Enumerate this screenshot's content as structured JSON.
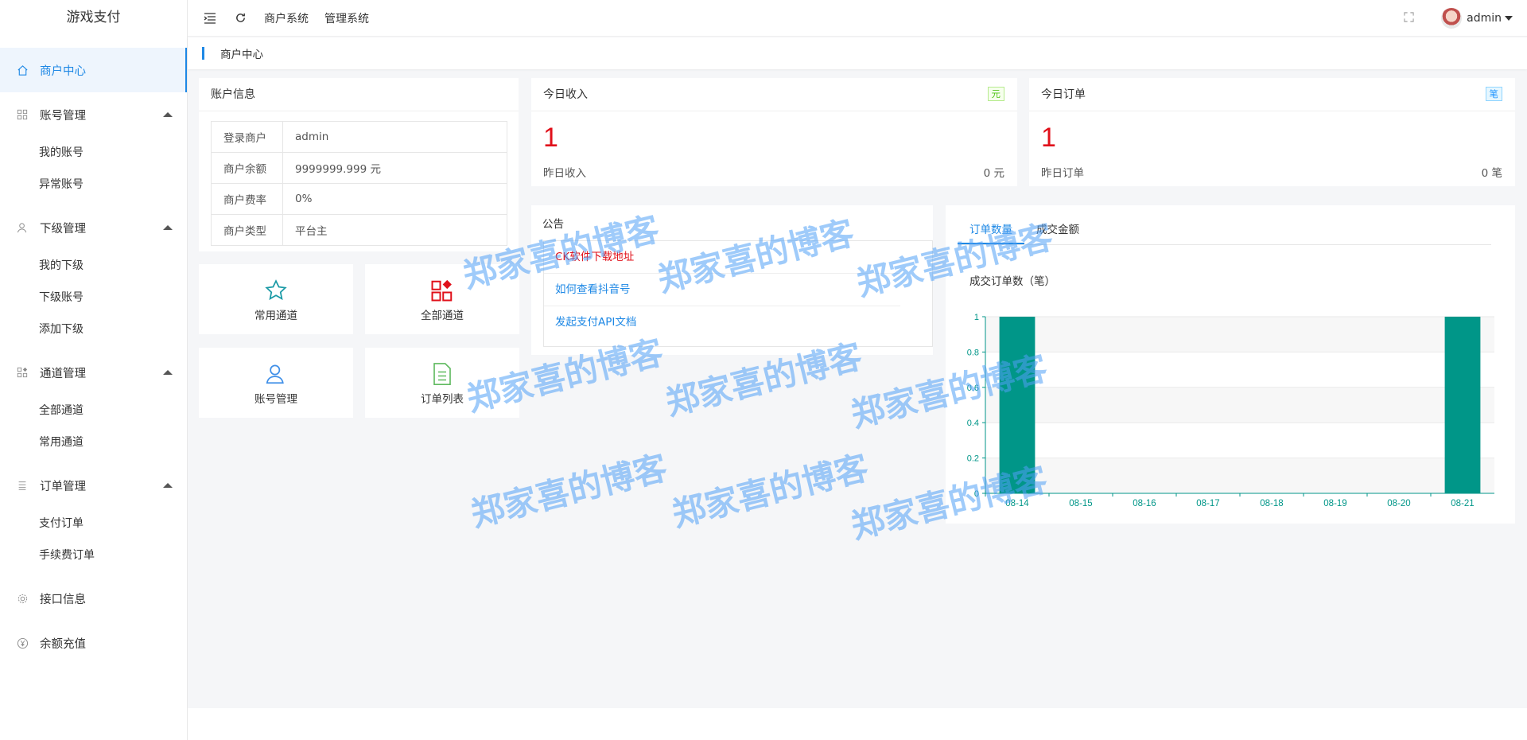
{
  "app": {
    "title": "游戏支付"
  },
  "sidebar": {
    "items": [
      {
        "label": "商户中心",
        "icon": "home-icon",
        "active": true
      },
      {
        "label": "账号管理",
        "icon": "grid-icon",
        "children": [
          "我的账号",
          "异常账号"
        ]
      },
      {
        "label": "下级管理",
        "icon": "user-icon",
        "children": [
          "我的下级",
          "下级账号",
          "添加下级"
        ]
      },
      {
        "label": "通道管理",
        "icon": "apps-icon",
        "children": [
          "全部通道",
          "常用通道"
        ]
      },
      {
        "label": "订单管理",
        "icon": "list-icon",
        "children": [
          "支付订单",
          "手续费订单"
        ]
      },
      {
        "label": "接口信息",
        "icon": "gear-icon"
      },
      {
        "label": "余额充值",
        "icon": "yen-icon"
      }
    ]
  },
  "header": {
    "links": [
      "商户系统",
      "管理系统"
    ],
    "user": "admin"
  },
  "breadcrumb": "商户中心",
  "account": {
    "title": "账户信息",
    "rows": [
      {
        "k": "登录商户",
        "v": "admin"
      },
      {
        "k": "商户余额",
        "v": "9999999.999 元"
      },
      {
        "k": "商户费率",
        "v": "0%"
      },
      {
        "k": "商户类型",
        "v": "平台主"
      }
    ]
  },
  "income": {
    "title": "今日收入",
    "badge": "元",
    "value": "1",
    "sub_label": "昨日收入",
    "sub_value": "0 元"
  },
  "orders": {
    "title": "今日订单",
    "badge": "笔",
    "value": "1",
    "sub_label": "昨日订单",
    "sub_value": "0 笔"
  },
  "quick": [
    "常用通道",
    "全部通道",
    "账号管理",
    "订单列表"
  ],
  "notice": {
    "title": "公告",
    "items": [
      "CK软件下载地址",
      "如何查看抖音号",
      "发起支付API文档"
    ]
  },
  "chart_tabs": [
    "订单数量",
    "成交金额"
  ],
  "watermark": "郑家喜的博客",
  "colors": {
    "accent": "#1e88e5",
    "bar": "#009688",
    "red": "#e0101a"
  },
  "chart_data": {
    "type": "bar",
    "title": "成交订单数（笔）",
    "categories": [
      "08-14",
      "08-15",
      "08-16",
      "08-17",
      "08-18",
      "08-19",
      "08-20",
      "08-21"
    ],
    "values": [
      1,
      0,
      0,
      0,
      0,
      0,
      0,
      1
    ],
    "ylim": [
      0,
      1
    ],
    "yticks": [
      0,
      0.2,
      0.4,
      0.6,
      0.8,
      1
    ],
    "grid": true
  }
}
